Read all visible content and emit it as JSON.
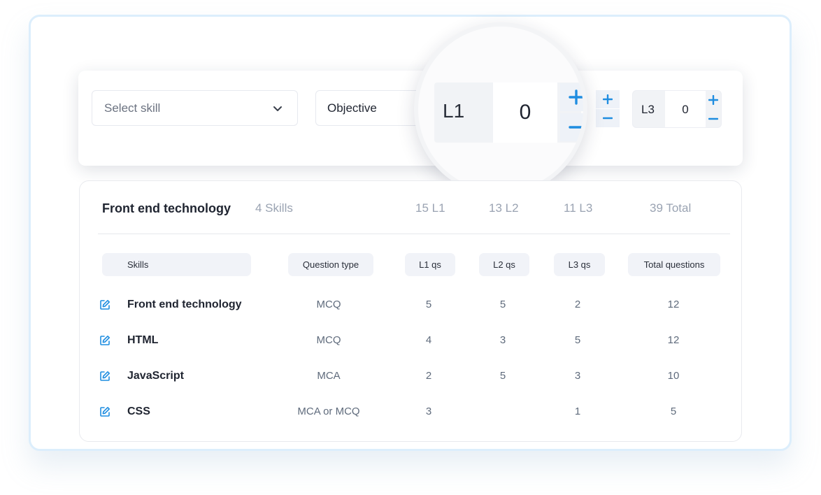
{
  "config": {
    "skill_select_placeholder": "Select skill",
    "question_type_value": "Objective",
    "l1": {
      "label": "L1",
      "value": "0"
    },
    "l3": {
      "label": "L3",
      "value": "0"
    }
  },
  "summary": {
    "title": "Front end technology",
    "skills_count": "4 Skills",
    "l1_total": "15 L1",
    "l2_total": "13 L2",
    "l3_total": "11 L3",
    "grand_total": "39 Total"
  },
  "table": {
    "headers": [
      "Skills",
      "Question type",
      "L1 qs",
      "L2 qs",
      "L3 qs",
      "Total questions"
    ],
    "rows": [
      {
        "skill": "Front end technology",
        "qtype": "MCQ",
        "l1": "5",
        "l2": "5",
        "l3": "2",
        "total": "12"
      },
      {
        "skill": "HTML",
        "qtype": "MCQ",
        "l1": "4",
        "l2": "3",
        "l3": "5",
        "total": "12"
      },
      {
        "skill": "JavaScript",
        "qtype": "MCA",
        "l1": "2",
        "l2": "5",
        "l3": "3",
        "total": "10"
      },
      {
        "skill": "CSS",
        "qtype": "MCA  or MCQ",
        "l1": "3",
        "l2": "",
        "l3": "1",
        "total": "5"
      }
    ]
  },
  "icons": {
    "dropdown": "chevron-down-icon",
    "increment": "plus-icon",
    "decrement": "minus-icon",
    "edit": "edit-icon"
  },
  "colors": {
    "accent": "#1f8de0",
    "frame_border": "#dceefc",
    "muted_text": "#9aa3b2"
  }
}
